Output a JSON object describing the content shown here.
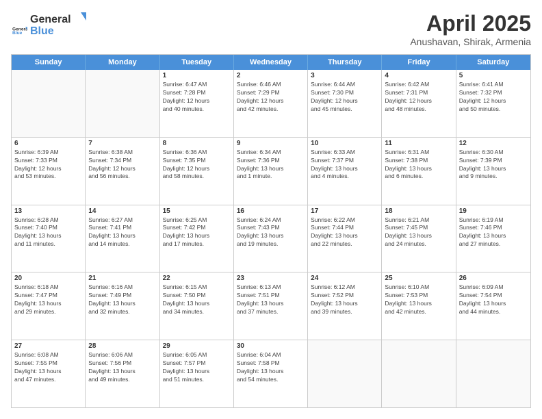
{
  "header": {
    "logo_general": "General",
    "logo_blue": "Blue",
    "title": "April 2025",
    "subtitle": "Anushavan, Shirak, Armenia"
  },
  "weekdays": [
    "Sunday",
    "Monday",
    "Tuesday",
    "Wednesday",
    "Thursday",
    "Friday",
    "Saturday"
  ],
  "rows": [
    [
      {
        "day": "",
        "lines": [],
        "empty": true
      },
      {
        "day": "",
        "lines": [],
        "empty": true
      },
      {
        "day": "1",
        "lines": [
          "Sunrise: 6:47 AM",
          "Sunset: 7:28 PM",
          "Daylight: 12 hours",
          "and 40 minutes."
        ]
      },
      {
        "day": "2",
        "lines": [
          "Sunrise: 6:46 AM",
          "Sunset: 7:29 PM",
          "Daylight: 12 hours",
          "and 42 minutes."
        ]
      },
      {
        "day": "3",
        "lines": [
          "Sunrise: 6:44 AM",
          "Sunset: 7:30 PM",
          "Daylight: 12 hours",
          "and 45 minutes."
        ]
      },
      {
        "day": "4",
        "lines": [
          "Sunrise: 6:42 AM",
          "Sunset: 7:31 PM",
          "Daylight: 12 hours",
          "and 48 minutes."
        ]
      },
      {
        "day": "5",
        "lines": [
          "Sunrise: 6:41 AM",
          "Sunset: 7:32 PM",
          "Daylight: 12 hours",
          "and 50 minutes."
        ]
      }
    ],
    [
      {
        "day": "6",
        "lines": [
          "Sunrise: 6:39 AM",
          "Sunset: 7:33 PM",
          "Daylight: 12 hours",
          "and 53 minutes."
        ]
      },
      {
        "day": "7",
        "lines": [
          "Sunrise: 6:38 AM",
          "Sunset: 7:34 PM",
          "Daylight: 12 hours",
          "and 56 minutes."
        ]
      },
      {
        "day": "8",
        "lines": [
          "Sunrise: 6:36 AM",
          "Sunset: 7:35 PM",
          "Daylight: 12 hours",
          "and 58 minutes."
        ]
      },
      {
        "day": "9",
        "lines": [
          "Sunrise: 6:34 AM",
          "Sunset: 7:36 PM",
          "Daylight: 13 hours",
          "and 1 minute."
        ]
      },
      {
        "day": "10",
        "lines": [
          "Sunrise: 6:33 AM",
          "Sunset: 7:37 PM",
          "Daylight: 13 hours",
          "and 4 minutes."
        ]
      },
      {
        "day": "11",
        "lines": [
          "Sunrise: 6:31 AM",
          "Sunset: 7:38 PM",
          "Daylight: 13 hours",
          "and 6 minutes."
        ]
      },
      {
        "day": "12",
        "lines": [
          "Sunrise: 6:30 AM",
          "Sunset: 7:39 PM",
          "Daylight: 13 hours",
          "and 9 minutes."
        ]
      }
    ],
    [
      {
        "day": "13",
        "lines": [
          "Sunrise: 6:28 AM",
          "Sunset: 7:40 PM",
          "Daylight: 13 hours",
          "and 11 minutes."
        ]
      },
      {
        "day": "14",
        "lines": [
          "Sunrise: 6:27 AM",
          "Sunset: 7:41 PM",
          "Daylight: 13 hours",
          "and 14 minutes."
        ]
      },
      {
        "day": "15",
        "lines": [
          "Sunrise: 6:25 AM",
          "Sunset: 7:42 PM",
          "Daylight: 13 hours",
          "and 17 minutes."
        ]
      },
      {
        "day": "16",
        "lines": [
          "Sunrise: 6:24 AM",
          "Sunset: 7:43 PM",
          "Daylight: 13 hours",
          "and 19 minutes."
        ]
      },
      {
        "day": "17",
        "lines": [
          "Sunrise: 6:22 AM",
          "Sunset: 7:44 PM",
          "Daylight: 13 hours",
          "and 22 minutes."
        ]
      },
      {
        "day": "18",
        "lines": [
          "Sunrise: 6:21 AM",
          "Sunset: 7:45 PM",
          "Daylight: 13 hours",
          "and 24 minutes."
        ]
      },
      {
        "day": "19",
        "lines": [
          "Sunrise: 6:19 AM",
          "Sunset: 7:46 PM",
          "Daylight: 13 hours",
          "and 27 minutes."
        ]
      }
    ],
    [
      {
        "day": "20",
        "lines": [
          "Sunrise: 6:18 AM",
          "Sunset: 7:47 PM",
          "Daylight: 13 hours",
          "and 29 minutes."
        ]
      },
      {
        "day": "21",
        "lines": [
          "Sunrise: 6:16 AM",
          "Sunset: 7:49 PM",
          "Daylight: 13 hours",
          "and 32 minutes."
        ]
      },
      {
        "day": "22",
        "lines": [
          "Sunrise: 6:15 AM",
          "Sunset: 7:50 PM",
          "Daylight: 13 hours",
          "and 34 minutes."
        ]
      },
      {
        "day": "23",
        "lines": [
          "Sunrise: 6:13 AM",
          "Sunset: 7:51 PM",
          "Daylight: 13 hours",
          "and 37 minutes."
        ]
      },
      {
        "day": "24",
        "lines": [
          "Sunrise: 6:12 AM",
          "Sunset: 7:52 PM",
          "Daylight: 13 hours",
          "and 39 minutes."
        ]
      },
      {
        "day": "25",
        "lines": [
          "Sunrise: 6:10 AM",
          "Sunset: 7:53 PM",
          "Daylight: 13 hours",
          "and 42 minutes."
        ]
      },
      {
        "day": "26",
        "lines": [
          "Sunrise: 6:09 AM",
          "Sunset: 7:54 PM",
          "Daylight: 13 hours",
          "and 44 minutes."
        ]
      }
    ],
    [
      {
        "day": "27",
        "lines": [
          "Sunrise: 6:08 AM",
          "Sunset: 7:55 PM",
          "Daylight: 13 hours",
          "and 47 minutes."
        ]
      },
      {
        "day": "28",
        "lines": [
          "Sunrise: 6:06 AM",
          "Sunset: 7:56 PM",
          "Daylight: 13 hours",
          "and 49 minutes."
        ]
      },
      {
        "day": "29",
        "lines": [
          "Sunrise: 6:05 AM",
          "Sunset: 7:57 PM",
          "Daylight: 13 hours",
          "and 51 minutes."
        ]
      },
      {
        "day": "30",
        "lines": [
          "Sunrise: 6:04 AM",
          "Sunset: 7:58 PM",
          "Daylight: 13 hours",
          "and 54 minutes."
        ]
      },
      {
        "day": "",
        "lines": [],
        "empty": true
      },
      {
        "day": "",
        "lines": [],
        "empty": true
      },
      {
        "day": "",
        "lines": [],
        "empty": true
      }
    ]
  ]
}
